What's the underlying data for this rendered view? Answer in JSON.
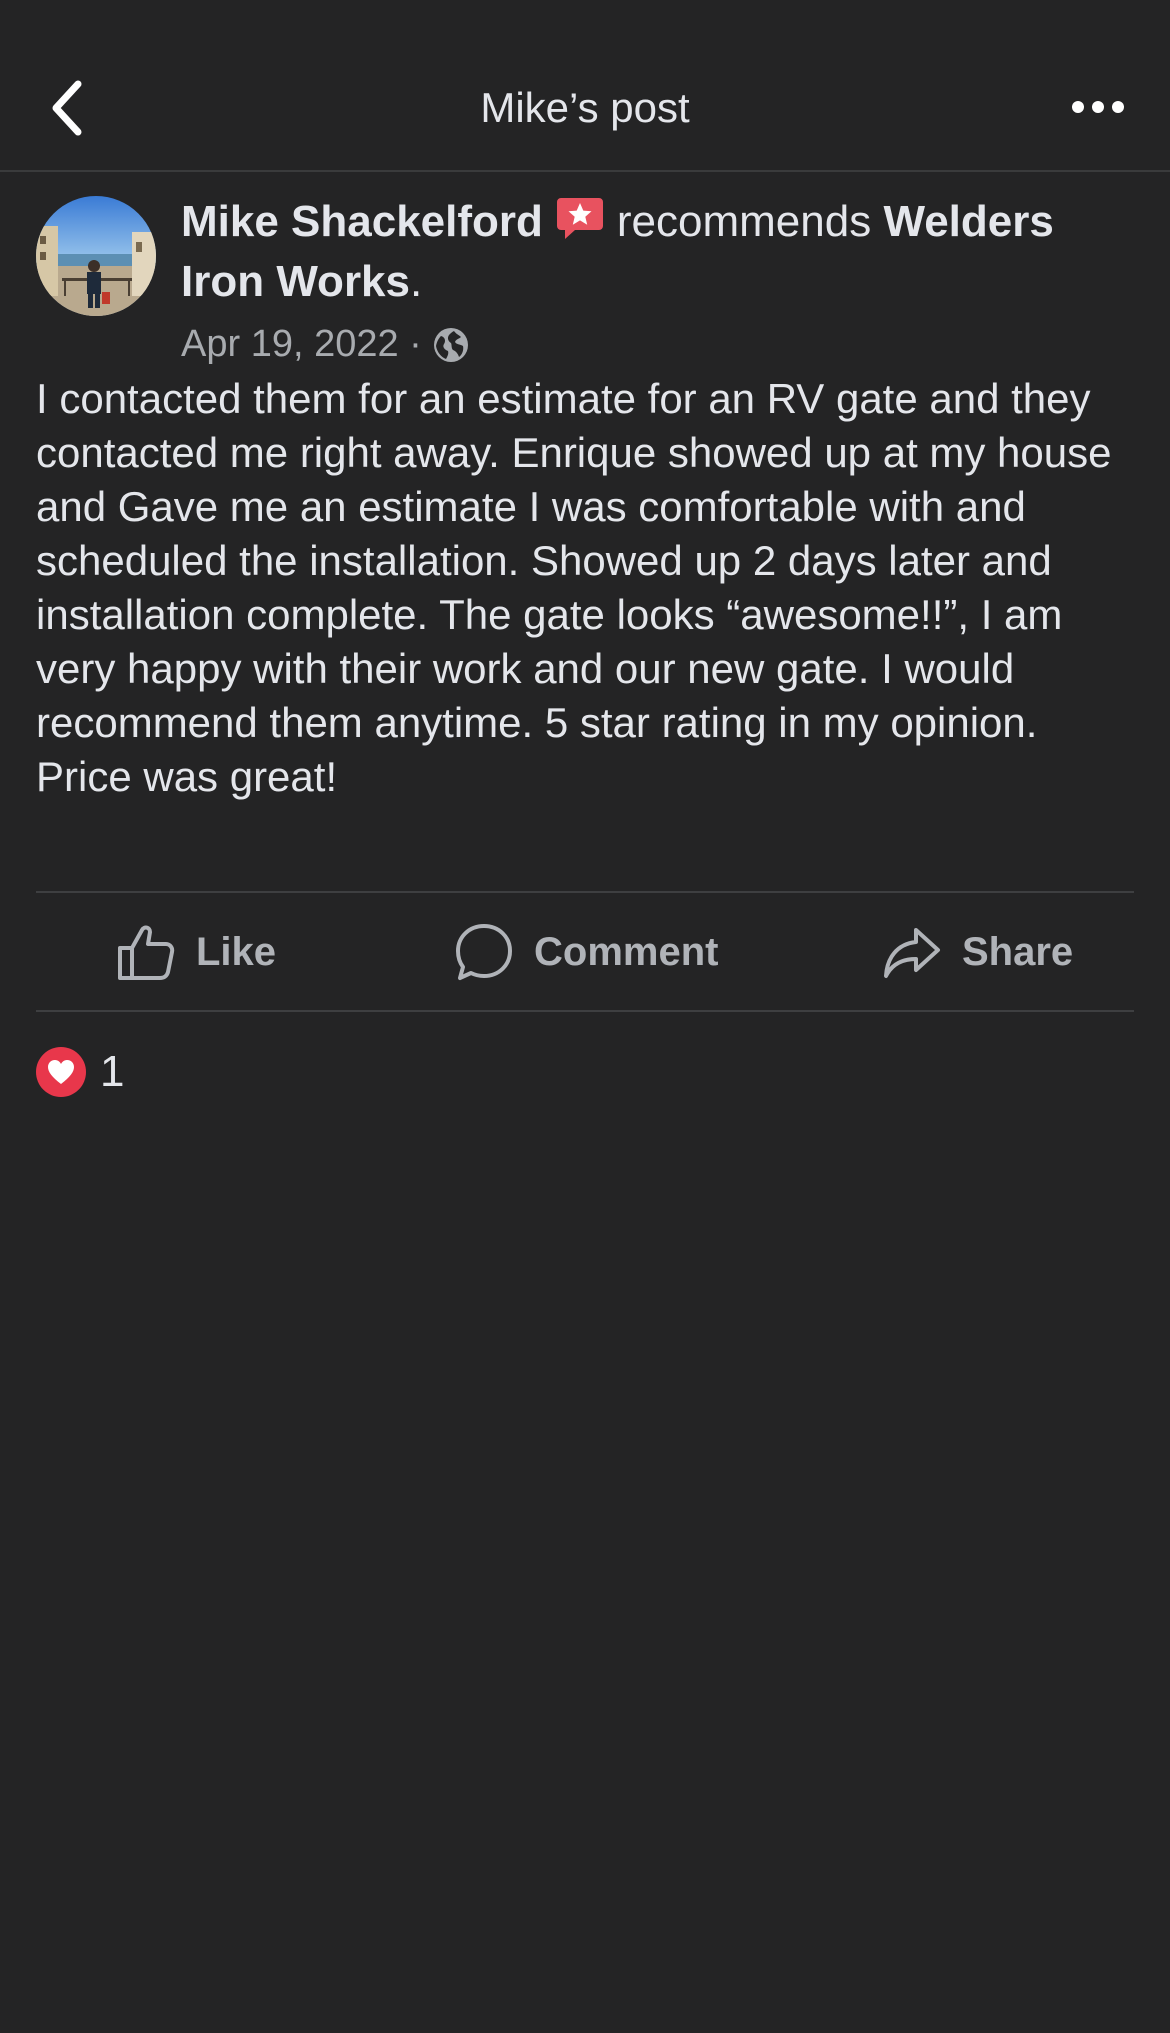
{
  "header": {
    "title": "Mike’s post",
    "back_icon": "chevron-left-icon",
    "more_icon": "more-horizontal-icon"
  },
  "post": {
    "author": "Mike Shackelford",
    "badge_icon": "recommendation-star-icon",
    "action_text": "recommends",
    "business": "Welders Iron Works",
    "period": ".",
    "date": "Apr 19, 2022",
    "separator": "·",
    "privacy_icon": "globe-icon",
    "body": "I contacted them for an estimate for an RV gate and they contacted me right away. Enrique showed up at my house and Gave me an estimate I was comfortable with and scheduled the installation. Showed up 2 days later and installation complete. The gate looks “awesome!!”, I am very happy with their work and our new gate. I would recommend them anytime. 5 star rating in my opinion. Price was great!"
  },
  "actions": {
    "like_label": "Like",
    "comment_label": "Comment",
    "share_label": "Share"
  },
  "reactions": {
    "icon": "heart-reaction-icon",
    "count": "1"
  },
  "colors": {
    "background": "#242425",
    "primary_text": "#e4e6eb",
    "secondary_text": "#a8abaf",
    "divider": "#3e3f41",
    "badge_red": "#e8374b"
  }
}
